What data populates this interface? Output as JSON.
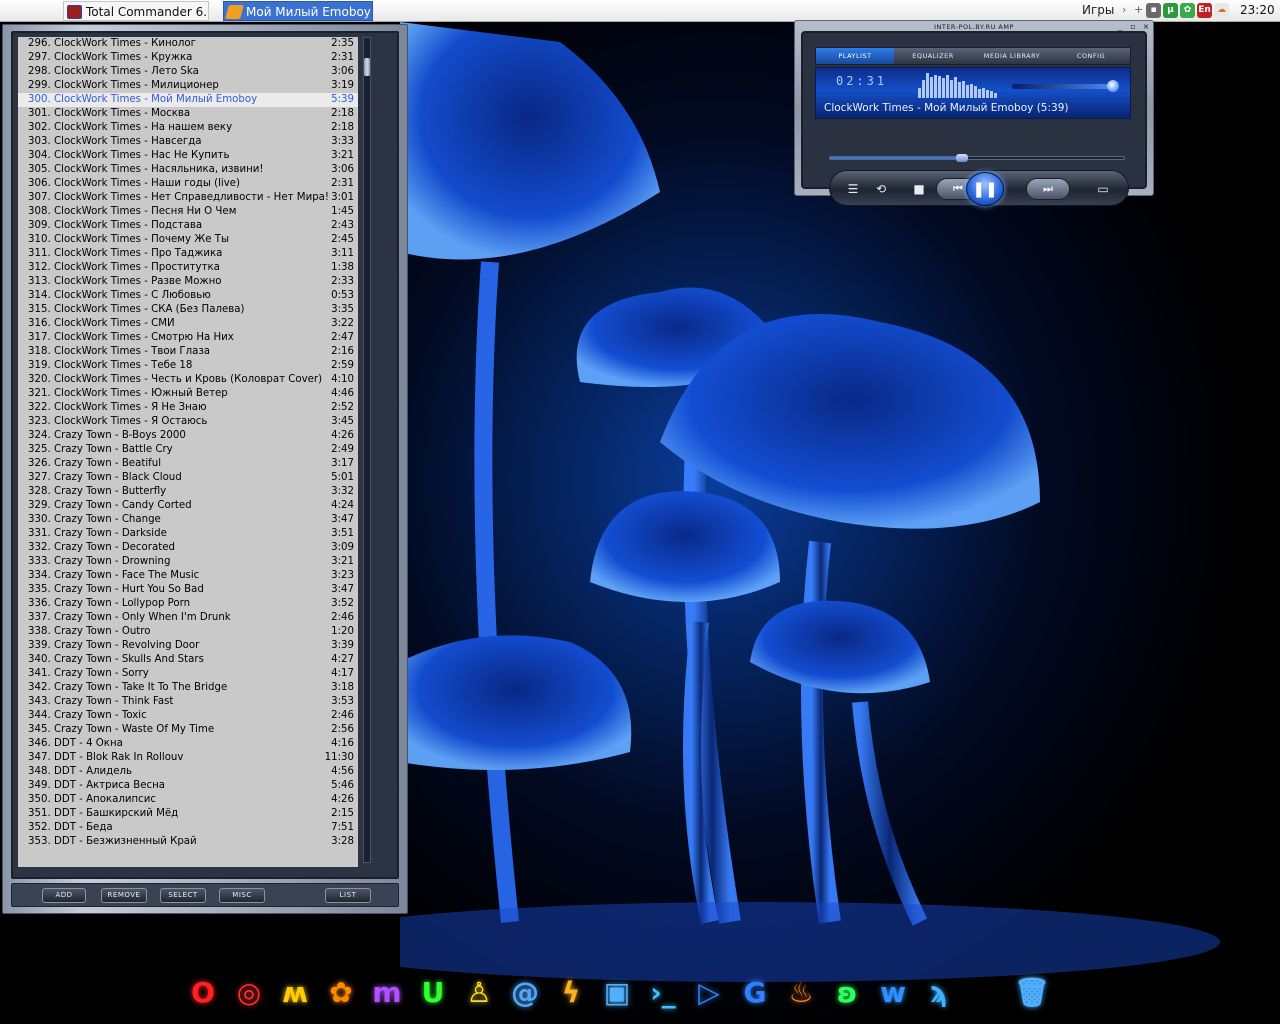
{
  "taskbar": {
    "apple_icon": "apple-icon",
    "tasks": [
      {
        "label": "Total Commander 6....",
        "icon": "total-commander-icon"
      },
      {
        "label": "Мой Милый Emoboy ...",
        "icon": "player-icon"
      }
    ],
    "games_label": "Игры",
    "tray_lang": "En",
    "clock": "23:20"
  },
  "playlist": {
    "tracks": [
      {
        "n": "296.",
        "title": "ClockWork Times - Кинолог",
        "dur": "2:35"
      },
      {
        "n": "297.",
        "title": "ClockWork Times - Кружка",
        "dur": "2:31"
      },
      {
        "n": "298.",
        "title": "ClockWork Times - Лето Ska",
        "dur": "3:06"
      },
      {
        "n": "299.",
        "title": "ClockWork Times - Милиционер",
        "dur": "3:19"
      },
      {
        "n": "300.",
        "title": "ClockWork Times - Мой Милый Emoboy",
        "dur": "5:39",
        "active": true
      },
      {
        "n": "301.",
        "title": "ClockWork Times - Москва",
        "dur": "2:18"
      },
      {
        "n": "302.",
        "title": "ClockWork Times - На нашем веку",
        "dur": "2:18"
      },
      {
        "n": "303.",
        "title": "ClockWork Times - Навсегда",
        "dur": "3:33"
      },
      {
        "n": "304.",
        "title": "ClockWork Times - Нас Не Купить",
        "dur": "3:21"
      },
      {
        "n": "305.",
        "title": "ClockWork Times - Насяльника, извини!",
        "dur": "3:06"
      },
      {
        "n": "306.",
        "title": "ClockWork Times - Наши годы (live)",
        "dur": "2:31"
      },
      {
        "n": "307.",
        "title": "ClockWork Times - Нет Справедливости - Нет Мира!",
        "dur": "3:01"
      },
      {
        "n": "308.",
        "title": "ClockWork Times - Песня Ни О Чем",
        "dur": "1:45"
      },
      {
        "n": "309.",
        "title": "ClockWork Times - Подстава",
        "dur": "2:43"
      },
      {
        "n": "310.",
        "title": "ClockWork Times - Почему Же Ты",
        "dur": "2:45"
      },
      {
        "n": "311.",
        "title": "ClockWork Times - Про Таджика",
        "dur": "3:11"
      },
      {
        "n": "312.",
        "title": "ClockWork Times - Проститутка",
        "dur": "1:38"
      },
      {
        "n": "313.",
        "title": "ClockWork Times - Разве Можно",
        "dur": "2:33"
      },
      {
        "n": "314.",
        "title": "ClockWork Times - С Любовью",
        "dur": "0:53"
      },
      {
        "n": "315.",
        "title": "ClockWork Times - СКА (Без Палева)",
        "dur": "3:35"
      },
      {
        "n": "316.",
        "title": "ClockWork Times - СМИ",
        "dur": "3:22"
      },
      {
        "n": "317.",
        "title": "ClockWork Times - Смотрю На Них",
        "dur": "2:47"
      },
      {
        "n": "318.",
        "title": "ClockWork Times - Твои Глаза",
        "dur": "2:16"
      },
      {
        "n": "319.",
        "title": "ClockWork Times - Тебе 18",
        "dur": "2:59"
      },
      {
        "n": "320.",
        "title": "ClockWork Times - Честь и Кровь (Коловрат Cover)",
        "dur": "4:10"
      },
      {
        "n": "321.",
        "title": "ClockWork Times - Южный Ветер",
        "dur": "4:46"
      },
      {
        "n": "322.",
        "title": "ClockWork Times - Я Не Знаю",
        "dur": "2:52"
      },
      {
        "n": "323.",
        "title": "ClockWork Times - Я Остаюсь",
        "dur": "3:45"
      },
      {
        "n": "324.",
        "title": "Crazy Town - B-Boys 2000",
        "dur": "4:26"
      },
      {
        "n": "325.",
        "title": "Crazy Town - Battle Cry",
        "dur": "2:49"
      },
      {
        "n": "326.",
        "title": "Crazy Town - Beatiful",
        "dur": "3:17"
      },
      {
        "n": "327.",
        "title": "Crazy Town - Black Cloud",
        "dur": "5:01"
      },
      {
        "n": "328.",
        "title": "Crazy Town - Butterfly",
        "dur": "3:32"
      },
      {
        "n": "329.",
        "title": "Crazy Town - Candy Corted",
        "dur": "4:24"
      },
      {
        "n": "330.",
        "title": "Crazy Town - Change",
        "dur": "3:47"
      },
      {
        "n": "331.",
        "title": "Crazy Town - Darkside",
        "dur": "3:51"
      },
      {
        "n": "332.",
        "title": "Crazy Town - Decorated",
        "dur": "3:09"
      },
      {
        "n": "333.",
        "title": "Crazy Town - Drowning",
        "dur": "3:21"
      },
      {
        "n": "334.",
        "title": "Crazy Town - Face The Music",
        "dur": "3:23"
      },
      {
        "n": "335.",
        "title": "Crazy Town - Hurt You So Bad",
        "dur": "3:47"
      },
      {
        "n": "336.",
        "title": "Crazy Town - Lollypop Porn",
        "dur": "3:52"
      },
      {
        "n": "337.",
        "title": "Crazy Town - Only When I'm Drunk",
        "dur": "2:46"
      },
      {
        "n": "338.",
        "title": "Crazy Town - Outro",
        "dur": "1:20"
      },
      {
        "n": "339.",
        "title": "Crazy Town - Revolving Door",
        "dur": "3:39"
      },
      {
        "n": "340.",
        "title": "Crazy Town - Skulls And Stars",
        "dur": "4:27"
      },
      {
        "n": "341.",
        "title": "Crazy Town - Sorry",
        "dur": "4:17"
      },
      {
        "n": "342.",
        "title": "Crazy Town - Take It To The Bridge",
        "dur": "3:18"
      },
      {
        "n": "343.",
        "title": "Crazy Town - Think Fast",
        "dur": "3:53"
      },
      {
        "n": "344.",
        "title": "Crazy Town - Toxic",
        "dur": "2:46"
      },
      {
        "n": "345.",
        "title": "Crazy Town - Waste Of My Time",
        "dur": "2:56"
      },
      {
        "n": "346.",
        "title": "DDT - 4 Окна",
        "dur": "4:16"
      },
      {
        "n": "347.",
        "title": "DDT - Blok Rak In Rollouv",
        "dur": "11:30"
      },
      {
        "n": "348.",
        "title": "DDT - Алидель",
        "dur": "4:56"
      },
      {
        "n": "349.",
        "title": "DDT - Актриса Весна",
        "dur": "5:46"
      },
      {
        "n": "350.",
        "title": "DDT - Апокалипсис",
        "dur": "4:26"
      },
      {
        "n": "351.",
        "title": "DDT - Башкирский Мёд",
        "dur": "2:15"
      },
      {
        "n": "352.",
        "title": "DDT - Беда",
        "dur": "7:51"
      },
      {
        "n": "353.",
        "title": "DDT - Безжизненный Край",
        "dur": "3:28"
      }
    ],
    "buttons": {
      "add": "ADD",
      "remove": "REMOVE",
      "select": "SELECT",
      "misc": "MISC",
      "list": "LIST"
    }
  },
  "player": {
    "window_title": "INTER-POL.BY.RU AMP",
    "tabs": [
      "PLAYLIST",
      "EQUALIZER",
      "MEDIA LIBRARY",
      "CONFIG"
    ],
    "active_tab": 0,
    "time": "02:31",
    "now_playing": "ClockWork Times - Мой Милый Emoboy (5:39)",
    "seek_fraction": 0.45,
    "volume_fraction": 0.97,
    "spectrum_levels": [
      0.4,
      0.7,
      0.95,
      0.8,
      0.9,
      0.85,
      0.75,
      0.9,
      0.7,
      0.8,
      0.6,
      0.65,
      0.5,
      0.55,
      0.45,
      0.35,
      0.4,
      0.3,
      0.25,
      0.2
    ],
    "buttons": {
      "eq": "eq-icon",
      "repeat": "repeat-icon",
      "stop": "stop-icon",
      "prev": "previous-icon",
      "pause": "pause-icon",
      "next": "next-icon",
      "open": "open-folder-icon"
    }
  },
  "dock": [
    {
      "name": "opera-icon",
      "glyph": "O",
      "color": "#ff2020"
    },
    {
      "name": "mozilla-icon",
      "glyph": "◎",
      "color": "#ff3030"
    },
    {
      "name": "miranda-icon",
      "glyph": "ʍ",
      "color": "#ffcc00"
    },
    {
      "name": "flower-icon",
      "glyph": "✿",
      "color": "#ff8a00"
    },
    {
      "name": "media-icon",
      "glyph": "m",
      "color": "#b050ff"
    },
    {
      "name": "utorrent-icon",
      "glyph": "U",
      "color": "#30ff30"
    },
    {
      "name": "figure-icon",
      "glyph": "♙",
      "color": "#ffdd20"
    },
    {
      "name": "mail-icon",
      "glyph": "@",
      "color": "#50a8ff"
    },
    {
      "name": "lightning-icon",
      "glyph": "ϟ",
      "color": "#ffb020"
    },
    {
      "name": "save-icon",
      "glyph": "▣",
      "color": "#50b0ff"
    },
    {
      "name": "terminal-icon",
      "glyph": "›_",
      "color": "#40c0ff"
    },
    {
      "name": "play-icon",
      "glyph": "▷",
      "color": "#3080ff"
    },
    {
      "name": "g-icon",
      "glyph": "G",
      "color": "#3080ff"
    },
    {
      "name": "burn-icon",
      "glyph": "♨",
      "color": "#ff8020"
    },
    {
      "name": "chat-icon",
      "glyph": "ʚ",
      "color": "#30ff60"
    },
    {
      "name": "word-icon",
      "glyph": "w",
      "color": "#3090ff"
    },
    {
      "name": "finder-icon",
      "glyph": "ϡ",
      "color": "#40b0ff"
    },
    {
      "name": "apple-icon",
      "glyph": "",
      "color": "#40a0ff"
    },
    {
      "name": "trash-icon",
      "glyph": "🗑",
      "color": "#50b0ff"
    }
  ]
}
